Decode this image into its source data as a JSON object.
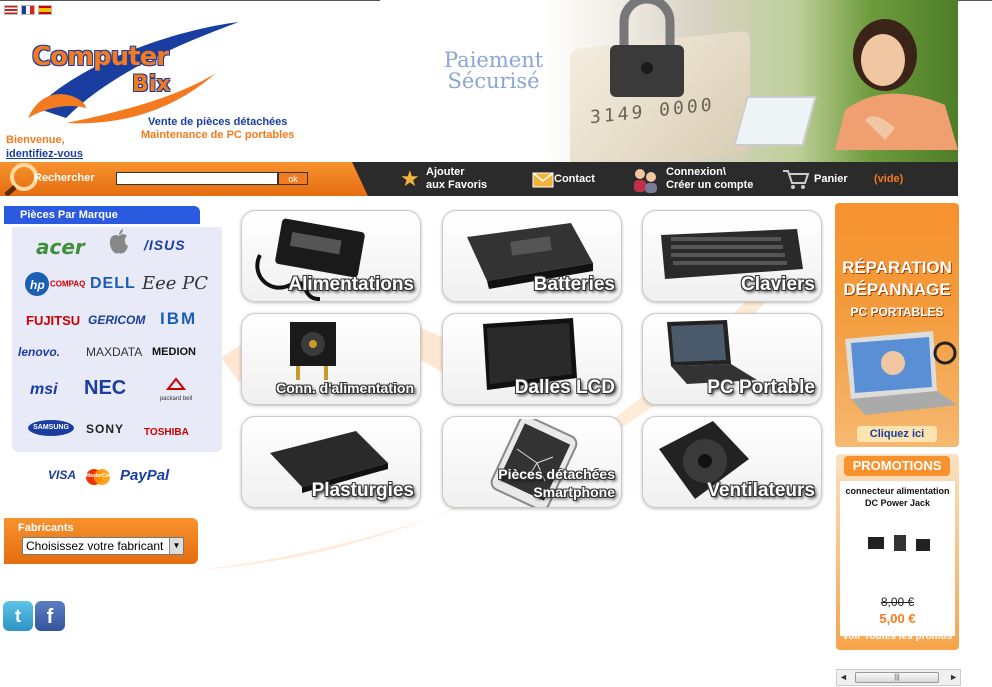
{
  "languages": [
    "english-flag-icon",
    "french-flag-icon",
    "spanish-flag-icon"
  ],
  "logo": {
    "word1": "Computer",
    "word2": "Bix"
  },
  "tagline": {
    "line1": "Vente de pièces détachées",
    "line2": "Maintenance de PC portables"
  },
  "welcome": {
    "text": "Bienvenue,",
    "link": "identifiez-vous"
  },
  "banner": {
    "line1": "Paiement",
    "line2": "Sécurisé"
  },
  "nav": {
    "search_label": "Rechercher",
    "search_value": "",
    "ok_label": "ok",
    "favorites_line1": "Ajouter",
    "favorites_line2": "aux Favoris",
    "contact": "Contact",
    "login_line1": "Connexion\\",
    "login_line2": "Créer un compte",
    "cart": "Panier",
    "cart_status": "(vide)"
  },
  "brands": {
    "title": "Pièces Par Marque",
    "items": [
      "acer",
      "",
      "/ISUS",
      "COMPAQ",
      "DELL",
      "Eee PC",
      "FUJITSU",
      "GERICOM",
      "IBM",
      "lenovo.",
      "MAXDATA",
      "MEDION",
      "msi",
      "NEC",
      "packard bell",
      "SAMSUNG",
      "SONY",
      "TOSHIBA"
    ]
  },
  "payments": [
    "VISA",
    "MasterCard",
    "PayPal"
  ],
  "manufacturers": {
    "title": "Fabricants",
    "selected": "Choisissez votre fabricant"
  },
  "social": [
    "twitter-icon",
    "facebook-icon"
  ],
  "categories": [
    {
      "label": "Alimentations"
    },
    {
      "label": "Batteries"
    },
    {
      "label": "Claviers"
    },
    {
      "label": "Conn. d'alimentation"
    },
    {
      "label": "Dalles LCD"
    },
    {
      "label": "PC Portable"
    },
    {
      "label": "Plasturgies"
    },
    {
      "label": "Pièces détachées Smartphone"
    },
    {
      "label": "Ventilateurs"
    }
  ],
  "repair_ad": {
    "line1": "RÉPARATION",
    "line2": "DÉPANNAGE",
    "line3": "PC PORTABLES",
    "cta": "Cliquez ici"
  },
  "promotions": {
    "title": "PROMOTIONS",
    "product": "connecteur alimentation DC Power Jack",
    "old_price": "8,00 €",
    "new_price": "5,00 €",
    "all_link": "voir Toutes les promos"
  },
  "colors": {
    "orange": "#f47a1f",
    "blue": "#2a5adf",
    "dark": "#2b2b2b"
  }
}
